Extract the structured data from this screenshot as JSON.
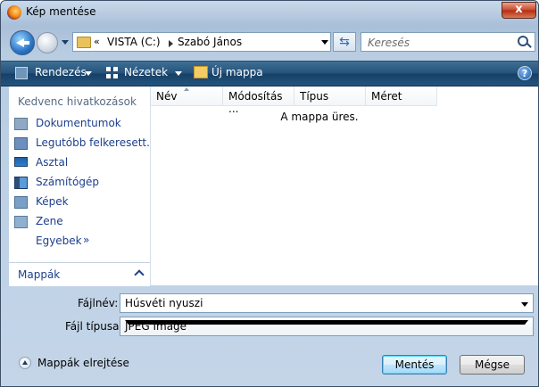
{
  "window": {
    "title": "Kép mentése",
    "close_glyph": "x"
  },
  "address_bar": {
    "overflow": "«",
    "segments": [
      "VISTA (C:)",
      "Szabó János"
    ]
  },
  "search": {
    "placeholder": "Keresés"
  },
  "toolbar": {
    "organize": "Rendezés",
    "views": "Nézetek",
    "new_folder": "Új mappa",
    "help": "?"
  },
  "sidebar": {
    "heading": "Kedvenc hivatkozások",
    "items": [
      {
        "label": "Dokumentumok",
        "icon": "documents-icon"
      },
      {
        "label": "Legutóbb felkeresett...",
        "icon": "recent-places-icon"
      },
      {
        "label": "Asztal",
        "icon": "desktop-icon"
      },
      {
        "label": "Számítógép",
        "icon": "computer-icon"
      },
      {
        "label": "Képek",
        "icon": "pictures-icon"
      },
      {
        "label": "Zene",
        "icon": "music-icon"
      }
    ],
    "more": "Egyebek",
    "more_glyph": "»",
    "folders": "Mappák"
  },
  "file_list": {
    "columns": [
      "Név",
      "Módosítás ...",
      "Típus",
      "Méret"
    ],
    "empty_message": "A mappa üres."
  },
  "form": {
    "filename_label": "Fájlnév:",
    "filename_value": "Húsvéti nyuszi",
    "filetype_label": "Fájl típusa:",
    "filetype_value": "JPEG Image"
  },
  "footer": {
    "hide_folders": "Mappák elrejtése",
    "save": "Mentés",
    "cancel": "Mégse"
  },
  "colors": {
    "toolbar": "#23517a",
    "link": "#1c3f8c",
    "close": "#c9462a"
  }
}
